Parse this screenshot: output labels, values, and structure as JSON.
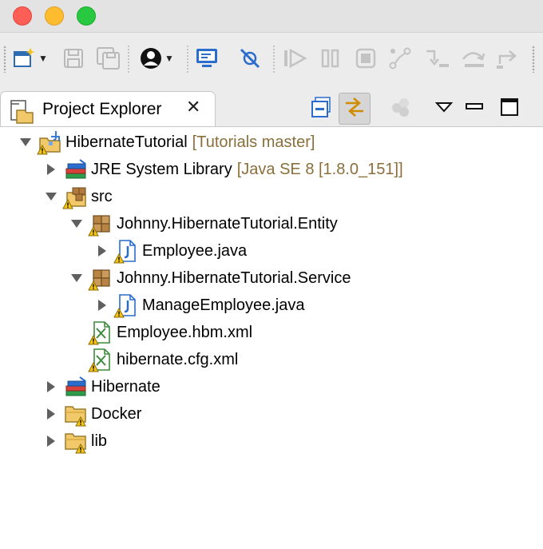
{
  "window": {
    "buttons": [
      "close",
      "minimize",
      "maximize"
    ]
  },
  "toolbar": {
    "icons": [
      "new-wizard-icon",
      "save-icon",
      "save-all-icon",
      "perspective-icon",
      "console-icon",
      "skip-breakpoints-icon",
      "resume-icon",
      "suspend-icon",
      "terminate-icon",
      "disconnect-icon",
      "step-into-icon",
      "step-over-icon",
      "step-return-icon"
    ]
  },
  "view": {
    "tab_label": "Project Explorer",
    "close_glyph": "✕"
  },
  "tree": {
    "items": [
      {
        "label": "HibernateTutorial",
        "decoration": "[Tutorials master]",
        "icon": "java-project-icon"
      },
      {
        "label": "JRE System Library",
        "decoration": "[Java SE 8 [1.8.0_151]]",
        "icon": "library-icon"
      },
      {
        "label": "src",
        "decoration": "",
        "icon": "source-folder-icon"
      },
      {
        "label": "Johnny.HibernateTutorial.Entity",
        "decoration": "",
        "icon": "package-icon"
      },
      {
        "label": "Employee.java",
        "decoration": "",
        "icon": "java-file-icon"
      },
      {
        "label": "Johnny.HibernateTutorial.Service",
        "decoration": "",
        "icon": "package-icon"
      },
      {
        "label": "ManageEmployee.java",
        "decoration": "",
        "icon": "java-file-icon"
      },
      {
        "label": "Employee.hbm.xml",
        "decoration": "",
        "icon": "xml-file-icon"
      },
      {
        "label": "hibernate.cfg.xml",
        "decoration": "",
        "icon": "xml-file-icon"
      },
      {
        "label": "Hibernate",
        "decoration": "",
        "icon": "library-icon"
      },
      {
        "label": "Docker",
        "decoration": "",
        "icon": "folder-icon"
      },
      {
        "label": "lib",
        "decoration": "",
        "icon": "folder-icon"
      }
    ]
  },
  "colors": {
    "decoration": "#8b6f3b",
    "accent": "#2a6dcc"
  }
}
